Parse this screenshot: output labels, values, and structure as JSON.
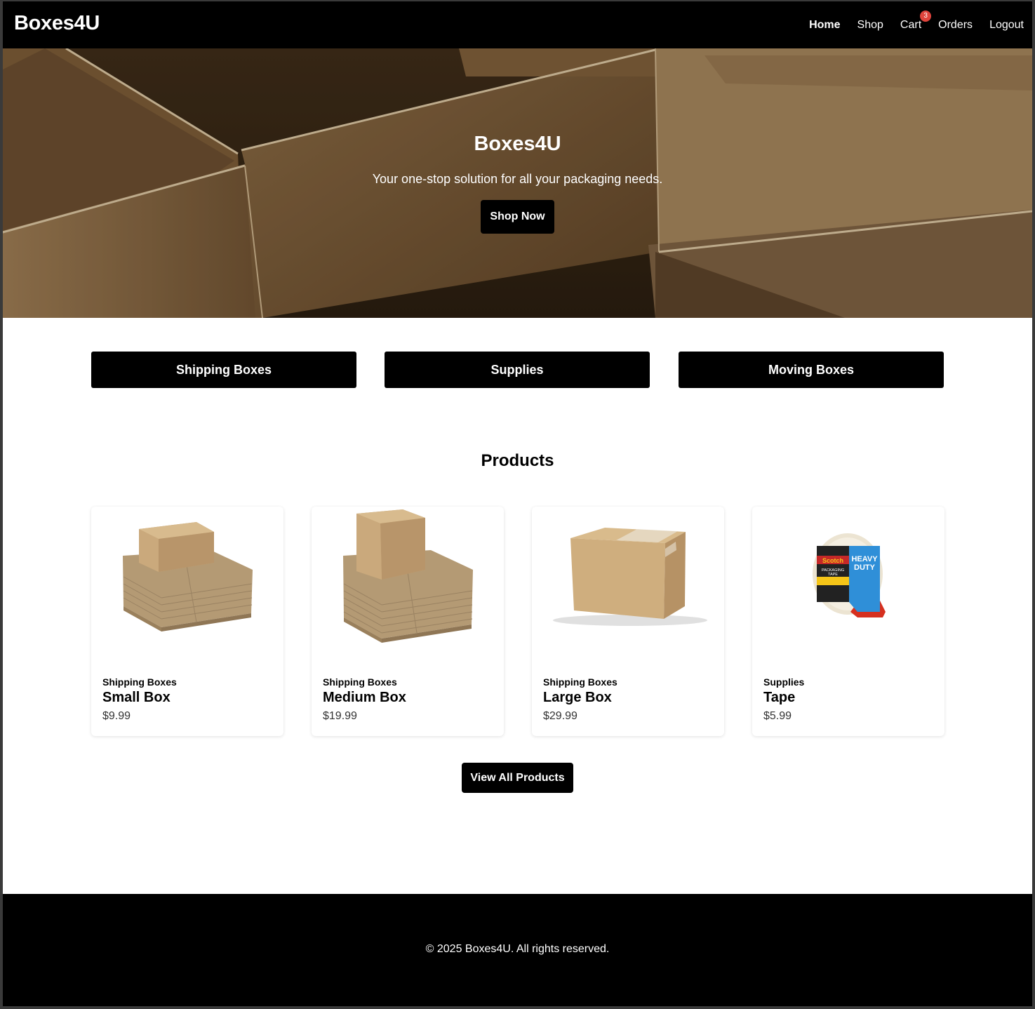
{
  "nav": {
    "brand": "Boxes4U",
    "links": [
      {
        "label": "Home",
        "active": true
      },
      {
        "label": "Shop"
      },
      {
        "label": "Cart",
        "badge": "3"
      },
      {
        "label": "Orders"
      },
      {
        "label": "Logout"
      }
    ]
  },
  "hero": {
    "title": "Boxes4U",
    "subtitle": "Your one-stop solution for all your packaging needs.",
    "cta": "Shop Now"
  },
  "categories": [
    "Shipping Boxes",
    "Supplies",
    "Moving Boxes"
  ],
  "products_section": {
    "title": "Products",
    "items": [
      {
        "category": "Shipping Boxes",
        "name": "Small Box",
        "price": "$9.99",
        "image": "stacked-small-boxes"
      },
      {
        "category": "Shipping Boxes",
        "name": "Medium Box",
        "price": "$19.99",
        "image": "stacked-medium-boxes"
      },
      {
        "category": "Shipping Boxes",
        "name": "Large Box",
        "price": "$29.99",
        "image": "large-box"
      },
      {
        "category": "Supplies",
        "name": "Tape",
        "price": "$5.99",
        "image": "packaging-tape"
      }
    ],
    "view_all": "View All Products"
  },
  "tape_label": {
    "brand": "Scotch",
    "line1": "PACKAGING",
    "line2": "TAPE",
    "duty1": "HEAVY",
    "duty2": "DUTY"
  },
  "footer": {
    "copyright": "© 2025 Boxes4U. All rights reserved."
  },
  "colors": {
    "accent": "#000000",
    "badge": "#e0443c",
    "cardboard": "#c9a878"
  }
}
